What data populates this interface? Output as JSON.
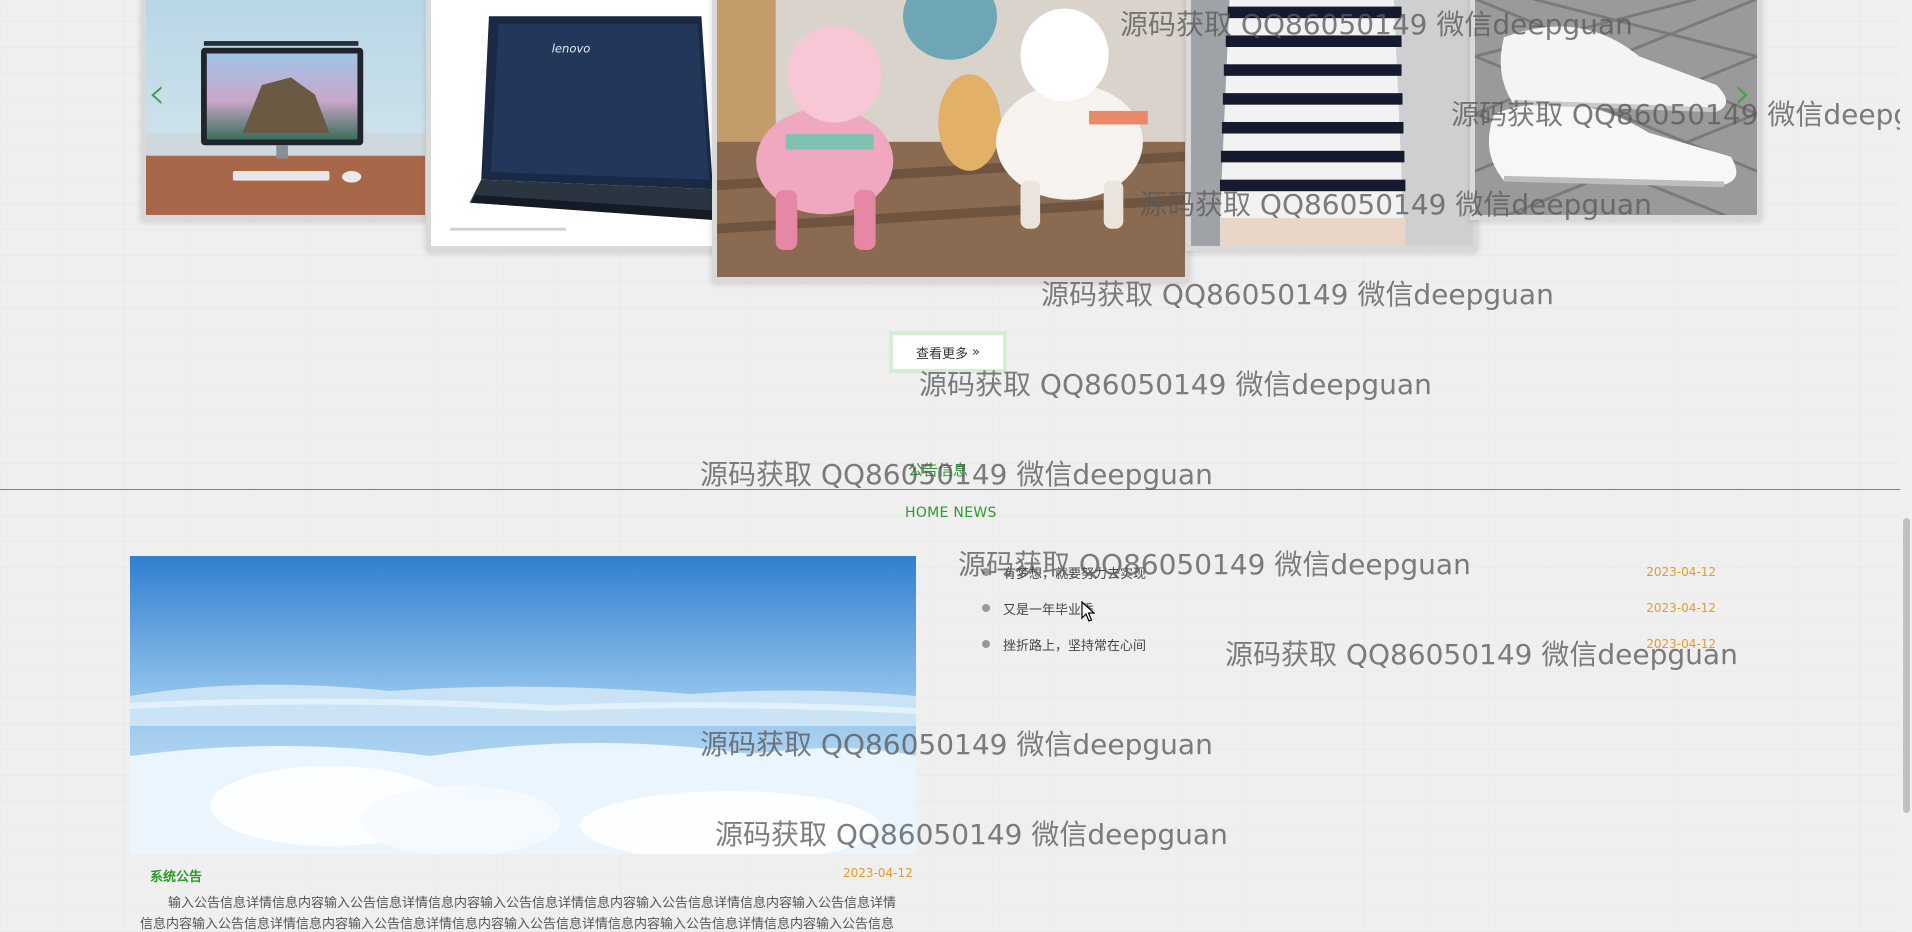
{
  "carousel": {
    "prev_icon": "chevron-left-icon",
    "next_icon": "chevron-right-icon",
    "prev_glyph": "‹",
    "next_glyph": "›",
    "products": [
      "desktop monitor",
      "lenovo laptop",
      "plush alpacas",
      "striped dress",
      "white sneakers"
    ],
    "laptop_brand": "lenovo",
    "more_button": "查看更多",
    "more_icon": "double-chevron-right-icon",
    "more_glyph": "»"
  },
  "news_section": {
    "title": "公告信息",
    "subtitle": "HOME NEWS"
  },
  "featured": {
    "title": "系统公告",
    "date": "2023-04-12",
    "content": "输入公告信息详情信息内容输入公告信息详情信息内容输入公告信息详情信息内容输入公告信息详情信息内容输入公告信息详情信息内容输入公告信息详情信息内容输入公告信息详情信息内容输入公告信息详情信息内容输入公告信息详情信息内容输入公告信息详情信息"
  },
  "news_list": [
    {
      "title": "有梦想，就要努力去实现",
      "date": "2023-04-12"
    },
    {
      "title": "又是一年毕业季",
      "date": "2023-04-12"
    },
    {
      "title": "挫折路上，坚持常在心间",
      "date": "2023-04-12"
    }
  ],
  "watermark_text": "源码获取 QQ86050149 微信deepguan",
  "colors": {
    "accent_green": "#2e9a2e",
    "date_orange": "#e89a2a",
    "background": "#efefef"
  }
}
